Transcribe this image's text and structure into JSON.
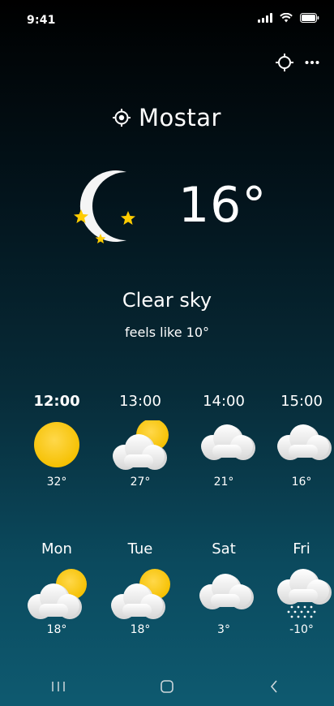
{
  "status": {
    "time": "9:41"
  },
  "location": {
    "name": "Mostar"
  },
  "current": {
    "temperature": "16°",
    "condition": "Clear sky",
    "feels_like": "feels like 10°",
    "icon": "moon-stars-icon"
  },
  "hourly": [
    {
      "time": "12:00",
      "temp": "32°",
      "icon": "sun-icon"
    },
    {
      "time": "13:00",
      "temp": "27°",
      "icon": "partly-cloudy-icon"
    },
    {
      "time": "14:00",
      "temp": "21°",
      "icon": "cloudy-icon"
    },
    {
      "time": "15:00",
      "temp": "16°",
      "icon": "cloudy-icon"
    }
  ],
  "daily": [
    {
      "day": "Mon",
      "temp": "18°",
      "icon": "partly-cloudy-icon"
    },
    {
      "day": "Tue",
      "temp": "18°",
      "icon": "partly-cloudy-icon"
    },
    {
      "day": "Sat",
      "temp": "3°",
      "icon": "cloudy-icon"
    },
    {
      "day": "Fri",
      "temp": "-10°",
      "icon": "snow-icon"
    }
  ],
  "colors": {
    "sun": "#FFCC00",
    "cloud": "#F2F2F2",
    "star": "#FFCC00"
  }
}
